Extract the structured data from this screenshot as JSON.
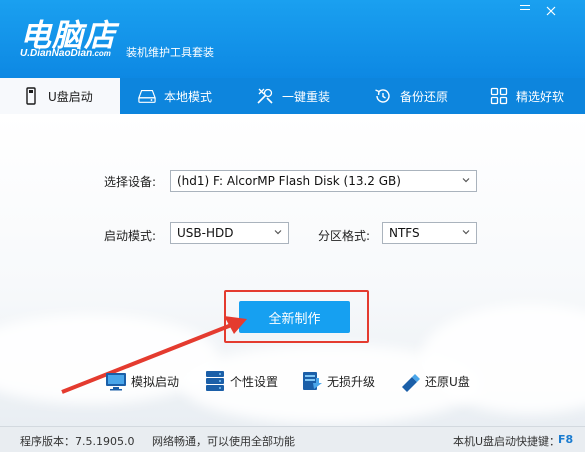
{
  "header": {
    "logo": "电脑店",
    "logo_sub": "U.DianNaoDian",
    "logo_sub_suffix": ".com",
    "tagline": "装机维护工具套装",
    "accent": "#0d88e3"
  },
  "nav": {
    "items": [
      {
        "label": "U盘启动",
        "icon": "usb-icon",
        "active": true
      },
      {
        "label": "本地模式",
        "icon": "hard-disk-icon",
        "active": false
      },
      {
        "label": "一键重装",
        "icon": "tools-icon",
        "active": false
      },
      {
        "label": "备份还原",
        "icon": "restore-icon",
        "active": false
      },
      {
        "label": "精选好软",
        "icon": "grid-icon",
        "active": false
      }
    ]
  },
  "form": {
    "device_label": "选择设备:",
    "device_value": "(hd1) F: AlcorMP Flash Disk (13.2 GB)",
    "boot_label": "启动模式:",
    "boot_value": "USB-HDD",
    "partition_label": "分区格式:",
    "partition_value": "NTFS"
  },
  "actions": {
    "make_label": "全新制作",
    "highlight_color": "#e43b2f"
  },
  "tools": [
    {
      "label": "模拟启动",
      "icon": "monitor-icon"
    },
    {
      "label": "个性设置",
      "icon": "server-icon"
    },
    {
      "label": "无损升级",
      "icon": "upgrade-icon"
    },
    {
      "label": "还原U盘",
      "icon": "usb-drive-icon"
    }
  ],
  "status": {
    "version": "程序版本：7.5.1905.0",
    "network": "网络畅通，可以使用全部功能",
    "hotkey_label": "本机U盘启动快捷键：",
    "hotkey_value": "F8"
  }
}
